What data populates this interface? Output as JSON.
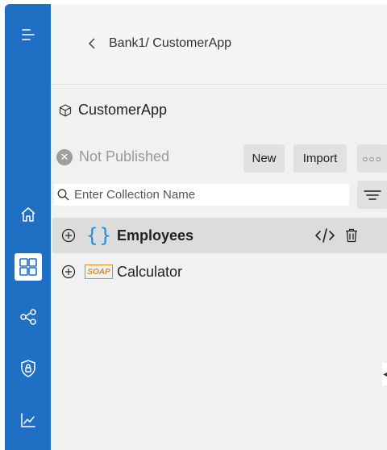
{
  "sidebar": {
    "items": [
      {
        "name": "menu",
        "icon": "hamburger-menu-icon"
      },
      {
        "name": "home",
        "icon": "home-icon"
      },
      {
        "name": "collections",
        "icon": "collections-grid-icon",
        "selected": true
      },
      {
        "name": "share",
        "icon": "share-nodes-icon"
      },
      {
        "name": "security",
        "icon": "shield-lock-icon"
      },
      {
        "name": "analytics",
        "icon": "line-chart-icon"
      }
    ],
    "color": "#1f6fc5"
  },
  "header": {
    "breadcrumb": "Bank1/ CustomerApp"
  },
  "app": {
    "title": "CustomerApp",
    "status": "Not Published"
  },
  "toolbar": {
    "new_label": "New",
    "import_label": "Import",
    "more_label": "○○○"
  },
  "search": {
    "placeholder": "Enter Collection Name",
    "value": ""
  },
  "collections": [
    {
      "name": "Employees",
      "type": "rest",
      "icon": "braces-icon",
      "selected": true
    },
    {
      "name": "Calculator",
      "type": "soap",
      "badge": "SOAP",
      "icon": "soap-badge-icon"
    }
  ],
  "colors": {
    "accent": "#1f6fc5",
    "rest_icon": "#1f8fe0",
    "soap_badge": "#e08a1e"
  }
}
